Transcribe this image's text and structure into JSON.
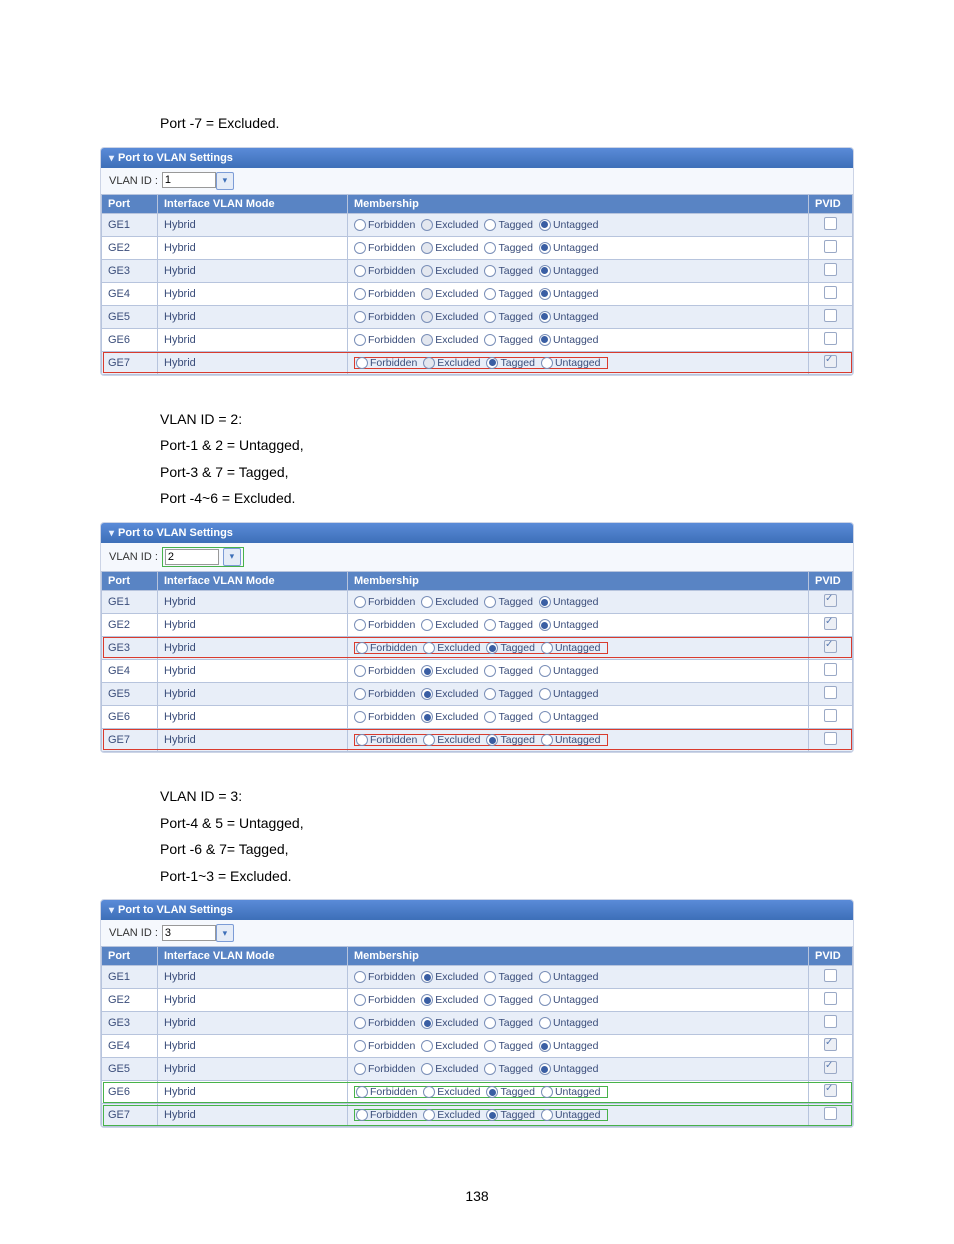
{
  "page_number": "138",
  "section1": {
    "header": "Port to VLAN Settings",
    "prose": [
      "Port -7 = Excluded."
    ],
    "vlan_label": "VLAN ID :",
    "vlan_value": "1",
    "cols": {
      "port": "Port",
      "mode": "Interface VLAN Mode",
      "memb": "Membership",
      "pvid": "PVID"
    },
    "mem_labels": {
      "forbidden": "Forbidden",
      "excluded": "Excluded",
      "tagged": "Tagged",
      "untagged": "Untagged"
    },
    "rows": [
      {
        "port": "GE1",
        "mode": "Hybrid",
        "sel": "untagged",
        "excl_disabled": true,
        "pvid": false
      },
      {
        "port": "GE2",
        "mode": "Hybrid",
        "sel": "untagged",
        "excl_disabled": true,
        "pvid": false
      },
      {
        "port": "GE3",
        "mode": "Hybrid",
        "sel": "untagged",
        "excl_disabled": true,
        "pvid": false
      },
      {
        "port": "GE4",
        "mode": "Hybrid",
        "sel": "untagged",
        "excl_disabled": true,
        "pvid": false
      },
      {
        "port": "GE5",
        "mode": "Hybrid",
        "sel": "untagged",
        "excl_disabled": true,
        "pvid": false
      },
      {
        "port": "GE6",
        "mode": "Hybrid",
        "sel": "untagged",
        "excl_disabled": true,
        "pvid": false
      },
      {
        "port": "GE7",
        "mode": "Hybrid",
        "sel": "tagged",
        "excl_disabled": true,
        "pvid": true,
        "pvid_disabled": true,
        "row_hl": "red",
        "cell_hl": true
      }
    ]
  },
  "section2": {
    "header": "Port to VLAN Settings",
    "prose": [
      "VLAN ID = 2:",
      "Port-1 & 2 = Untagged,",
      "Port-3 & 7 = Tagged,",
      "Port -4~6 = Excluded."
    ],
    "vlan_label": "VLAN ID :",
    "vlan_value": "2",
    "vlan_box_hl": "green",
    "cols": {
      "port": "Port",
      "mode": "Interface VLAN Mode",
      "memb": "Membership",
      "pvid": "PVID"
    },
    "mem_labels": {
      "forbidden": "Forbidden",
      "excluded": "Excluded",
      "tagged": "Tagged",
      "untagged": "Untagged"
    },
    "rows": [
      {
        "port": "GE1",
        "mode": "Hybrid",
        "sel": "untagged",
        "pvid": true,
        "pvid_disabled": true
      },
      {
        "port": "GE2",
        "mode": "Hybrid",
        "sel": "untagged",
        "pvid": true,
        "pvid_disabled": true
      },
      {
        "port": "GE3",
        "mode": "Hybrid",
        "sel": "tagged",
        "pvid": true,
        "pvid_disabled": true,
        "row_hl": "red",
        "cell_hl": true
      },
      {
        "port": "GE4",
        "mode": "Hybrid",
        "sel": "excluded",
        "pvid": false
      },
      {
        "port": "GE5",
        "mode": "Hybrid",
        "sel": "excluded",
        "pvid": false
      },
      {
        "port": "GE6",
        "mode": "Hybrid",
        "sel": "excluded",
        "pvid": false
      },
      {
        "port": "GE7",
        "mode": "Hybrid",
        "sel": "tagged",
        "pvid": false,
        "row_hl": "red",
        "cell_hl": true
      }
    ]
  },
  "section3": {
    "header": "Port to VLAN Settings",
    "prose": [
      "VLAN ID = 3:",
      "Port-4 & 5 = Untagged,",
      "Port -6 & 7= Tagged,",
      "Port-1~3 = Excluded."
    ],
    "vlan_label": "VLAN ID :",
    "vlan_value": "3",
    "cols": {
      "port": "Port",
      "mode": "Interface VLAN Mode",
      "memb": "Membership",
      "pvid": "PVID"
    },
    "mem_labels": {
      "forbidden": "Forbidden",
      "excluded": "Excluded",
      "tagged": "Tagged",
      "untagged": "Untagged"
    },
    "rows": [
      {
        "port": "GE1",
        "mode": "Hybrid",
        "sel": "excluded",
        "pvid": false
      },
      {
        "port": "GE2",
        "mode": "Hybrid",
        "sel": "excluded",
        "pvid": false
      },
      {
        "port": "GE3",
        "mode": "Hybrid",
        "sel": "excluded",
        "pvid": false
      },
      {
        "port": "GE4",
        "mode": "Hybrid",
        "sel": "untagged",
        "pvid": true,
        "pvid_disabled": true
      },
      {
        "port": "GE5",
        "mode": "Hybrid",
        "sel": "untagged",
        "pvid": true,
        "pvid_disabled": true
      },
      {
        "port": "GE6",
        "mode": "Hybrid",
        "sel": "tagged",
        "pvid": true,
        "pvid_disabled": true,
        "row_hl": "green",
        "cell_hl": true
      },
      {
        "port": "GE7",
        "mode": "Hybrid",
        "sel": "tagged",
        "pvid": false,
        "row_hl": "green",
        "cell_hl": true
      }
    ]
  }
}
